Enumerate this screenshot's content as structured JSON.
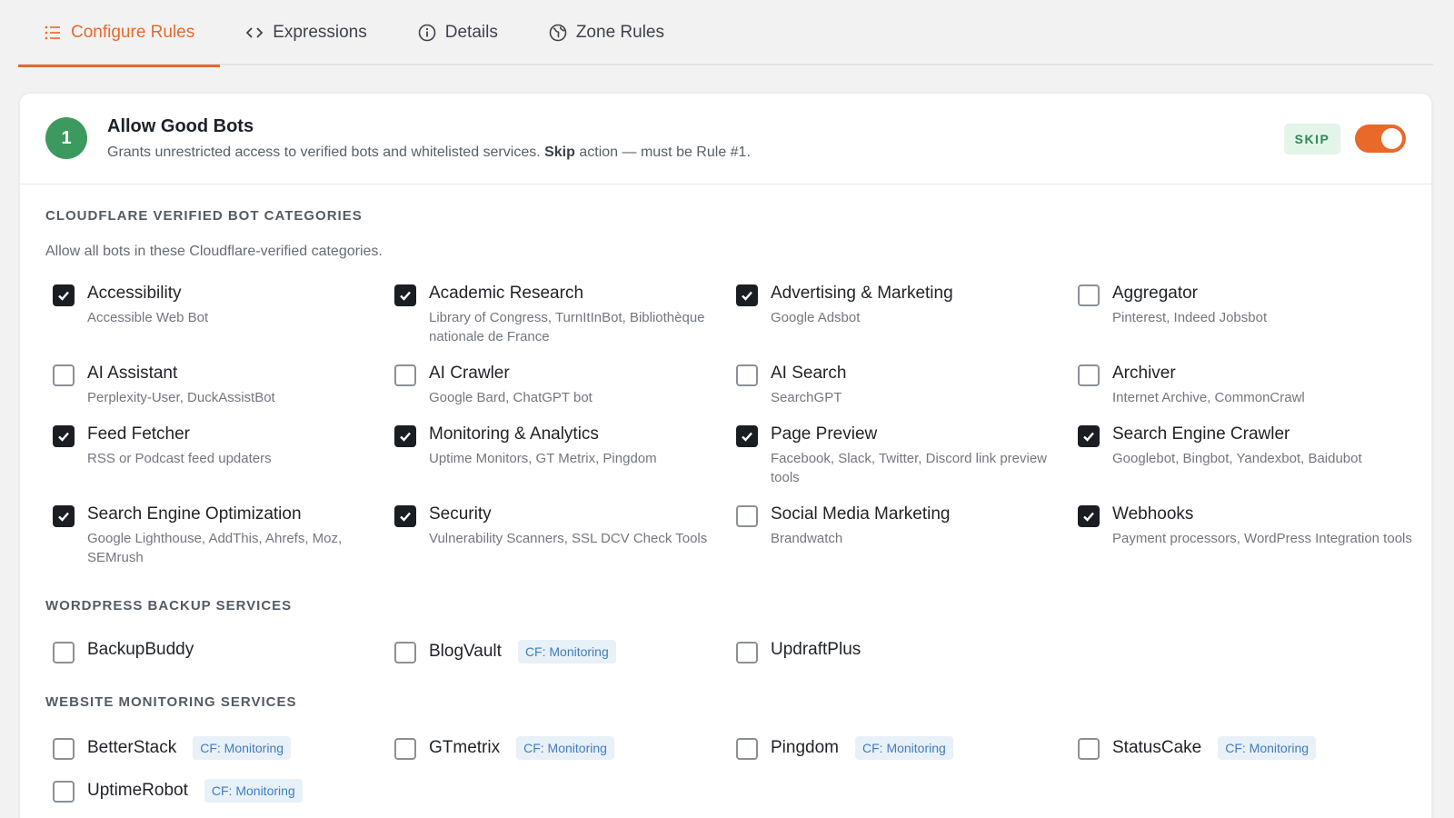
{
  "tabs": [
    {
      "label": "Configure Rules",
      "icon": "list-icon",
      "active": true
    },
    {
      "label": "Expressions",
      "icon": "code-icon",
      "active": false
    },
    {
      "label": "Details",
      "icon": "info-icon",
      "active": false
    },
    {
      "label": "Zone Rules",
      "icon": "globe-icon",
      "active": false
    }
  ],
  "rule": {
    "number": "1",
    "title": "Allow Good Bots",
    "desc_prefix": "Grants unrestricted access to verified bots and whitelisted services.",
    "desc_bold": "Skip",
    "desc_suffix": "action — must be Rule #1.",
    "action_badge": "SKIP",
    "enabled": true
  },
  "sections": {
    "verified": {
      "title": "CLOUDFLARE VERIFIED BOT CATEGORIES",
      "subtitle": "Allow all bots in these Cloudflare-verified categories.",
      "items": [
        {
          "label": "Accessibility",
          "sub": "Accessible Web Bot",
          "checked": true
        },
        {
          "label": "Academic Research",
          "sub": "Library of Congress, TurnItInBot, Bibliothèque nationale de France",
          "checked": true
        },
        {
          "label": "Advertising & Marketing",
          "sub": "Google Adsbot",
          "checked": true
        },
        {
          "label": "Aggregator",
          "sub": "Pinterest, Indeed Jobsbot",
          "checked": false
        },
        {
          "label": "AI Assistant",
          "sub": "Perplexity-User, DuckAssistBot",
          "checked": false
        },
        {
          "label": "AI Crawler",
          "sub": "Google Bard, ChatGPT bot",
          "checked": false
        },
        {
          "label": "AI Search",
          "sub": "SearchGPT",
          "checked": false
        },
        {
          "label": "Archiver",
          "sub": "Internet Archive, CommonCrawl",
          "checked": false
        },
        {
          "label": "Feed Fetcher",
          "sub": "RSS or Podcast feed updaters",
          "checked": true
        },
        {
          "label": "Monitoring & Analytics",
          "sub": "Uptime Monitors, GT Metrix, Pingdom",
          "checked": true
        },
        {
          "label": "Page Preview",
          "sub": "Facebook, Slack, Twitter, Discord link preview tools",
          "checked": true
        },
        {
          "label": "Search Engine Crawler",
          "sub": "Googlebot, Bingbot, Yandexbot, Baidubot",
          "checked": true
        },
        {
          "label": "Search Engine Optimization",
          "sub": "Google Lighthouse, AddThis, Ahrefs, Moz, SEMrush",
          "checked": true
        },
        {
          "label": "Security",
          "sub": "Vulnerability Scanners, SSL DCV Check Tools",
          "checked": true
        },
        {
          "label": "Social Media Marketing",
          "sub": "Brandwatch",
          "checked": false
        },
        {
          "label": "Webhooks",
          "sub": "Payment processors, WordPress Integration tools",
          "checked": true
        }
      ]
    },
    "backup": {
      "title": "WORDPRESS BACKUP SERVICES",
      "items": [
        {
          "label": "BackupBuddy",
          "tag": "",
          "checked": false
        },
        {
          "label": "BlogVault",
          "tag": "CF: Monitoring",
          "checked": false
        },
        {
          "label": "UpdraftPlus",
          "tag": "",
          "checked": false
        }
      ]
    },
    "monitoring": {
      "title": "WEBSITE MONITORING SERVICES",
      "items": [
        {
          "label": "BetterStack",
          "tag": "CF: Monitoring",
          "checked": false
        },
        {
          "label": "GTmetrix",
          "tag": "CF: Monitoring",
          "checked": false
        },
        {
          "label": "Pingdom",
          "tag": "CF: Monitoring",
          "checked": false
        },
        {
          "label": "StatusCake",
          "tag": "CF: Monitoring",
          "checked": false
        },
        {
          "label": "UptimeRobot",
          "tag": "CF: Monitoring",
          "checked": false
        }
      ]
    }
  },
  "colors": {
    "accent": "#e8692a",
    "rule_badge": "#3c9a5f",
    "skip_bg": "#e2f5e8",
    "skip_text": "#2f8a53"
  }
}
